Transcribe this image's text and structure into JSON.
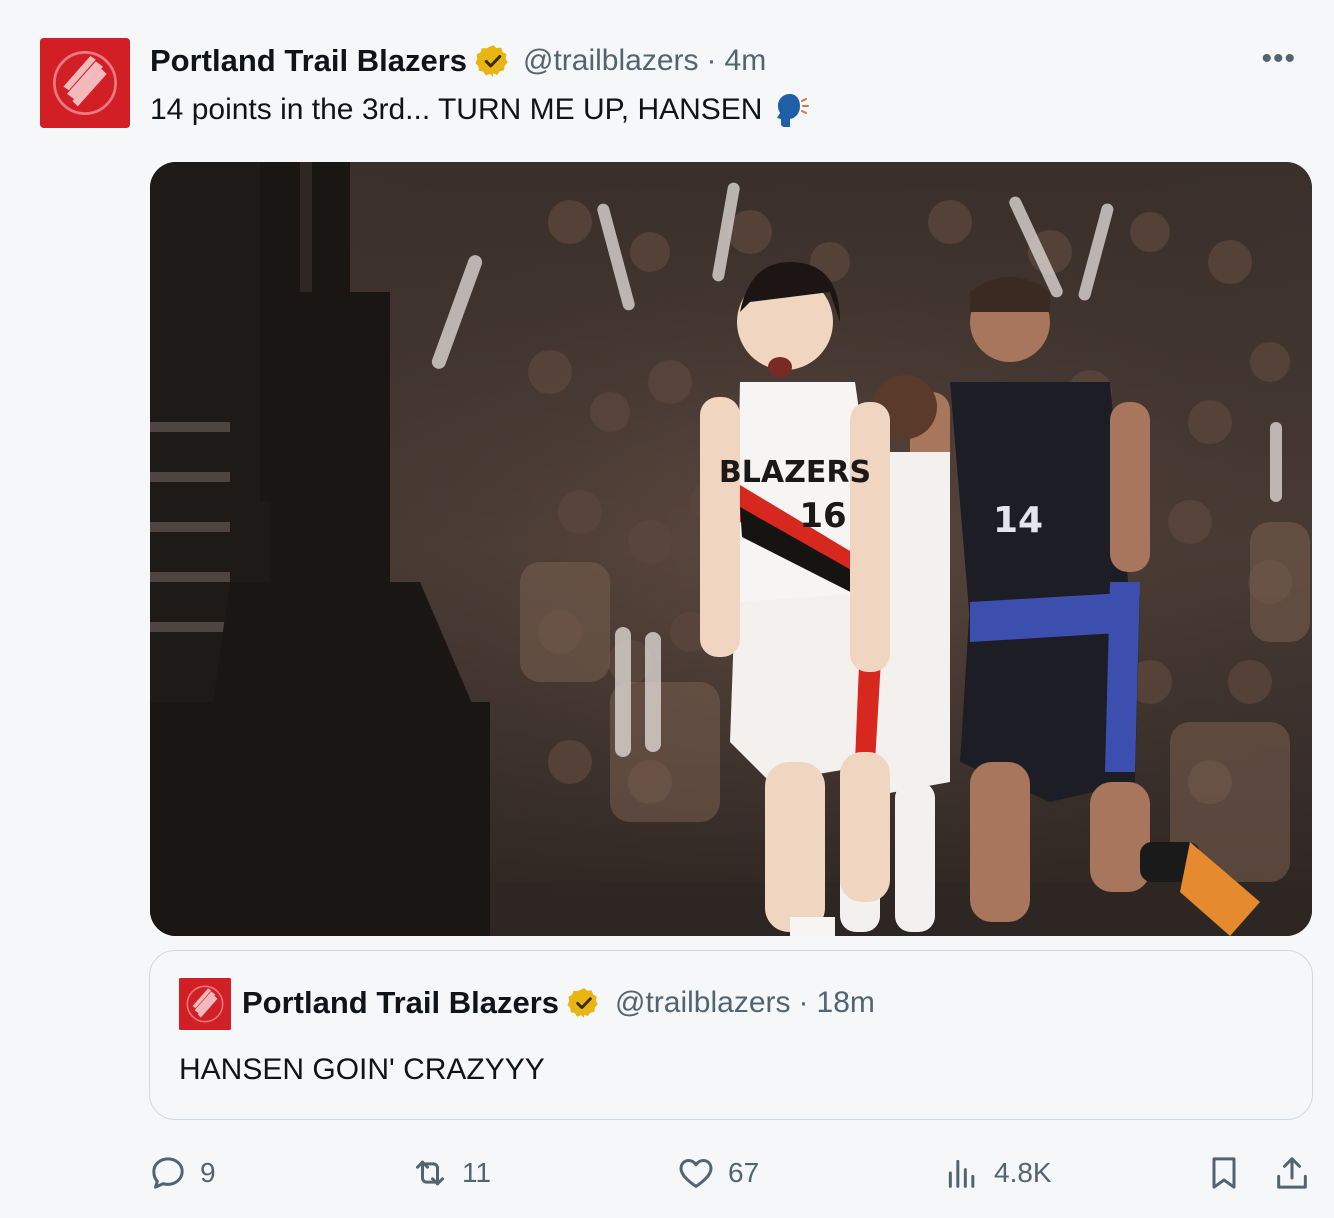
{
  "tweet": {
    "author_name": "Portland Trail Blazers",
    "handle": "@trailblazers",
    "separator": "·",
    "time": "4m",
    "more_label": "•••",
    "text": "14 points in the 3rd... TURN ME UP, HANSEN",
    "emoji_icon": "speaking-head-icon",
    "media": {
      "jersey_home_team": "BLAZERS",
      "jersey_home_number": "16",
      "jersey_away_number": "14"
    }
  },
  "quoted": {
    "author_name": "Portland Trail Blazers",
    "handle": "@trailblazers",
    "separator": "·",
    "time": "18m",
    "text": "HANSEN GOIN' CRAZYYY"
  },
  "actions": {
    "replies": "9",
    "reposts": "11",
    "likes": "67",
    "views": "4.8K"
  },
  "colors": {
    "brand_red": "#d21f26",
    "verified_gold": "#e8b512",
    "secondary_text": "#536471",
    "border": "#cfd9de"
  }
}
